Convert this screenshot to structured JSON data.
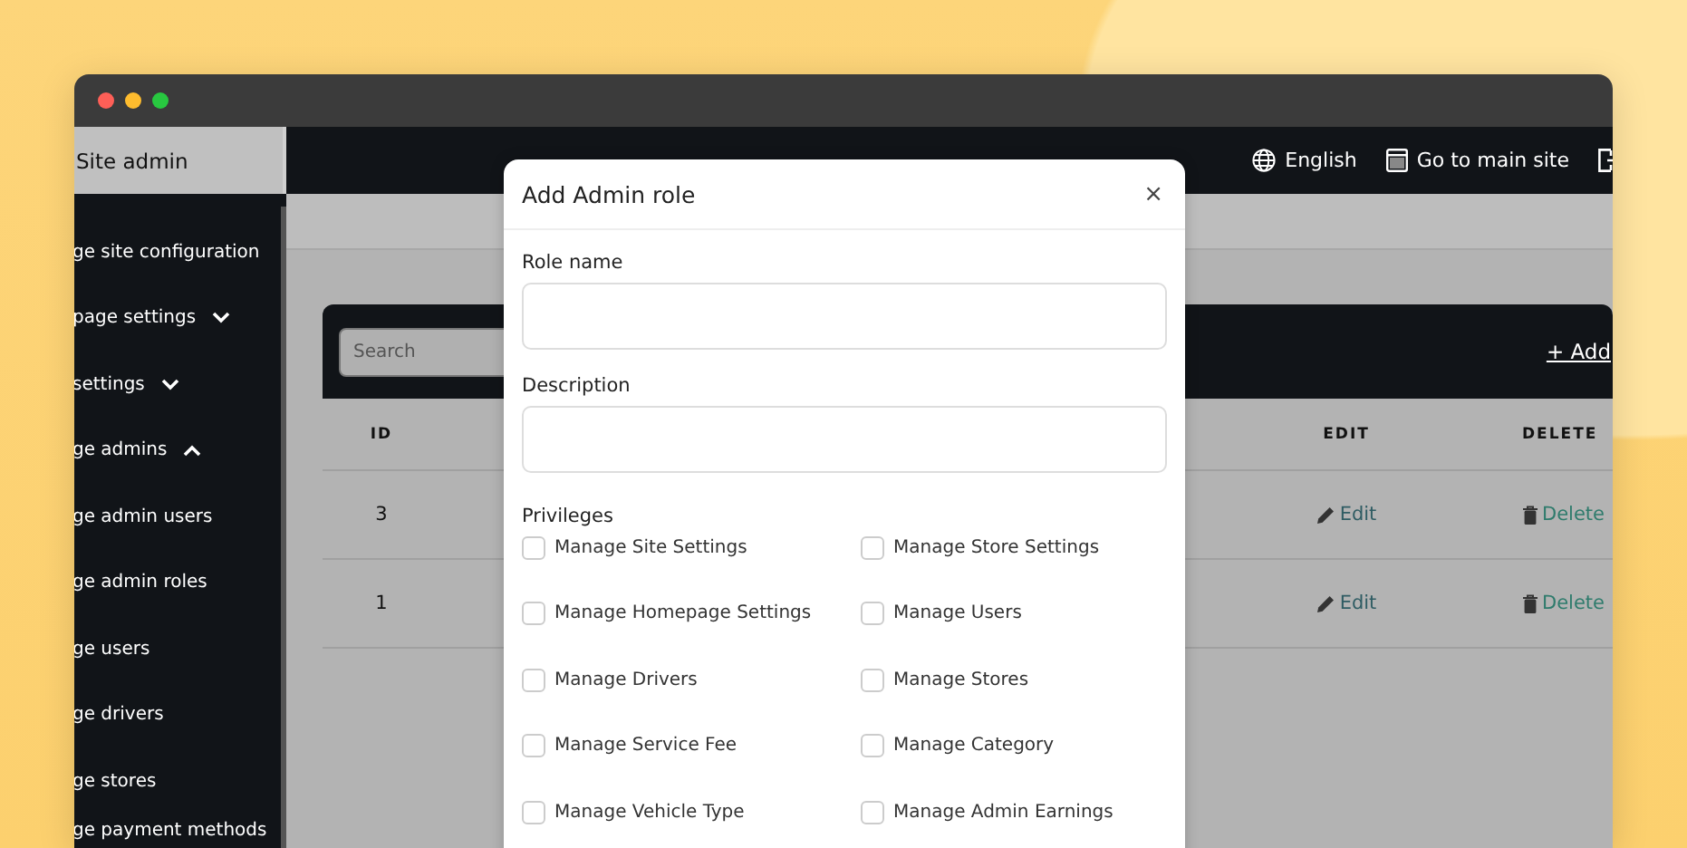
{
  "sidebar": {
    "title": "Site admin",
    "items": [
      {
        "label": "ge site configuration",
        "kind": "link"
      },
      {
        "label": "page settings",
        "kind": "group",
        "expanded": false
      },
      {
        "label": "settings",
        "kind": "group",
        "expanded": false
      },
      {
        "label": "ge admins",
        "kind": "group",
        "expanded": true
      },
      {
        "label": "ge admin users",
        "kind": "link"
      },
      {
        "label": "ge admin roles",
        "kind": "link"
      },
      {
        "label": "ge users",
        "kind": "link"
      },
      {
        "label": "ge drivers",
        "kind": "link"
      },
      {
        "label": "ge stores",
        "kind": "link"
      },
      {
        "label": "ge payment methods",
        "kind": "link"
      }
    ]
  },
  "topbar": {
    "links": [
      {
        "kind": "language",
        "label": "English"
      },
      {
        "kind": "site",
        "label": "Go to main site"
      },
      {
        "kind": "logout"
      }
    ]
  },
  "table": {
    "search": {
      "placeholder": "Search"
    },
    "add_link": "+ Add",
    "columns": [
      "ID",
      "EDIT",
      "DELETE"
    ],
    "rows": [
      {
        "id": "3",
        "edit": "Edit",
        "delete": "Delete"
      },
      {
        "id": "1",
        "edit": "Edit",
        "delete": "Delete"
      }
    ]
  },
  "modal": {
    "title": "Add Admin role",
    "close": "×",
    "fields": [
      {
        "label": "Role name"
      },
      {
        "label": "Description"
      }
    ],
    "privileges_label": "Privileges",
    "privileges": [
      {
        "label": "Manage Site Settings",
        "checked": false
      },
      {
        "label": "Manage Store Settings",
        "checked": false
      },
      {
        "label": "Manage Homepage Settings",
        "checked": false
      },
      {
        "label": "Manage Users",
        "checked": false
      },
      {
        "label": "Manage Drivers",
        "checked": false
      },
      {
        "label": "Manage Stores",
        "checked": false
      },
      {
        "label": "Manage Service Fee",
        "checked": false
      },
      {
        "label": "Manage Category",
        "checked": false
      },
      {
        "label": "Manage Vehicle Type",
        "checked": false
      },
      {
        "label": "Manage Admin Earnings",
        "checked": false
      }
    ]
  }
}
